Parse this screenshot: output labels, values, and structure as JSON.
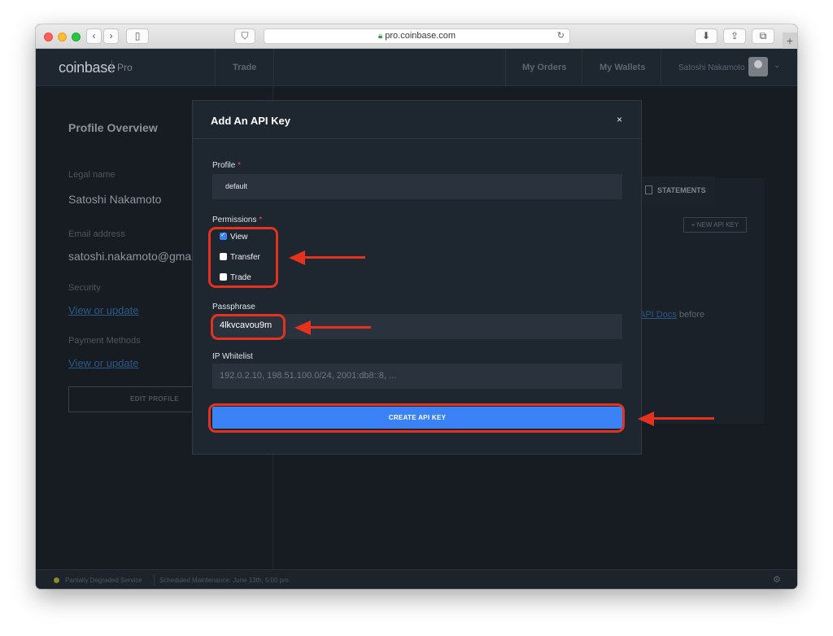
{
  "browser": {
    "url": "pro.coinbase.com"
  },
  "nav": {
    "logo": "coinbase",
    "logo_sub": "Pro",
    "trade": "Trade",
    "my_orders": "My Orders",
    "my_wallets": "My Wallets",
    "user_name": "Satoshi Nakamoto"
  },
  "profile": {
    "title": "Profile Overview",
    "legal_name_label": "Legal name",
    "legal_name": "Satoshi Nakamoto",
    "email_label": "Email address",
    "email": "satoshi.nakamoto@gmail",
    "security_label": "Security",
    "security_link": "View or update",
    "payment_label": "Payment Methods",
    "payment_link": "View or update",
    "edit_button": "EDIT PROFILE"
  },
  "api_panel": {
    "statements_tab": "STATEMENTS",
    "new_api_key": "+ NEW API KEY",
    "docs_link": "API Docs",
    "docs_suffix": "before"
  },
  "footer": {
    "status": "Partially Degraded Service",
    "maintenance": "Scheduled Maintenance: June 13th, 5:00 pm"
  },
  "modal": {
    "title": "Add An API Key",
    "close": "×",
    "profile_label": "Profile",
    "profile_value": "default",
    "permissions_label": "Permissions",
    "permissions": [
      {
        "label": "View",
        "checked": true
      },
      {
        "label": "Transfer",
        "checked": false
      },
      {
        "label": "Trade",
        "checked": false
      }
    ],
    "passphrase_label": "Passphrase",
    "passphrase_value": "4lkvcavou9m",
    "ip_label": "IP Whitelist",
    "ip_placeholder": "192.0.2.10, 198.51.100.0/24, 2001:db8::8, ...",
    "create_button": "CREATE API KEY",
    "required_mark": "*"
  },
  "colors": {
    "accent": "#3b82f6",
    "annotation": "#e4321e",
    "modal_bg": "#1e2630"
  }
}
